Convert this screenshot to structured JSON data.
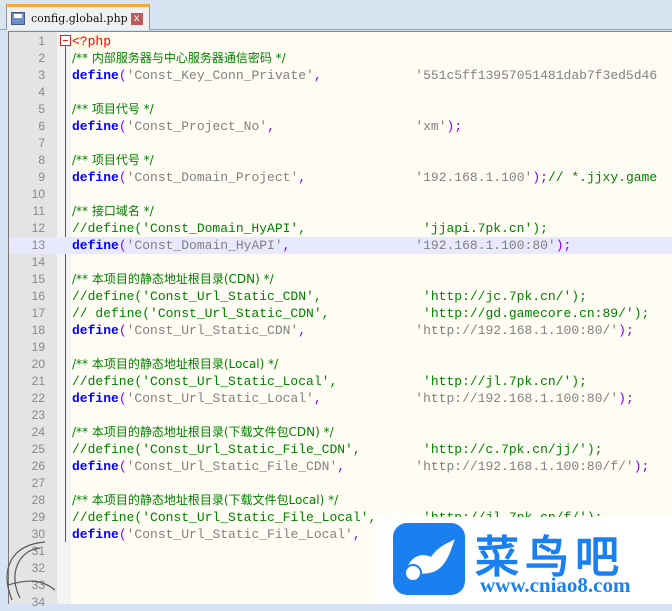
{
  "tab": {
    "filename": "config.global.php",
    "close": "x"
  },
  "highlighted_line": 13,
  "lines": [
    [
      {
        "t": "<?php",
        "c": "php"
      }
    ],
    [
      {
        "t": "/** 内部服务器与中心服务器通信密码 */",
        "c": "cmc"
      }
    ],
    [
      {
        "t": "define",
        "c": "kw"
      },
      {
        "t": "(",
        "c": "op"
      },
      {
        "t": "'Const_Key_Conn_Private'",
        "c": "str"
      },
      {
        "t": ",",
        "c": "op"
      },
      {
        "t": "            ",
        "c": ""
      },
      {
        "t": "'551c5ff13957051481dab7f3ed5d46",
        "c": "str"
      }
    ],
    [],
    [
      {
        "t": "/** 项目代号 */",
        "c": "cmc"
      }
    ],
    [
      {
        "t": "define",
        "c": "kw"
      },
      {
        "t": "(",
        "c": "op"
      },
      {
        "t": "'Const_Project_No'",
        "c": "str"
      },
      {
        "t": ",",
        "c": "op"
      },
      {
        "t": "                  ",
        "c": ""
      },
      {
        "t": "'xm'",
        "c": "str"
      },
      {
        "t": ");",
        "c": "op"
      }
    ],
    [],
    [
      {
        "t": "/** 项目代号 */",
        "c": "cmc"
      }
    ],
    [
      {
        "t": "define",
        "c": "kw"
      },
      {
        "t": "(",
        "c": "op"
      },
      {
        "t": "'Const_Domain_Project'",
        "c": "str"
      },
      {
        "t": ",",
        "c": "op"
      },
      {
        "t": "              ",
        "c": ""
      },
      {
        "t": "'192.168.1.100'",
        "c": "str"
      },
      {
        "t": ");",
        "c": "op"
      },
      {
        "t": "// *.jjxy.game",
        "c": "cm"
      }
    ],
    [],
    [
      {
        "t": "/** 接口域名 */",
        "c": "cmc"
      }
    ],
    [
      {
        "t": "//define('Const_Domain_HyAPI',               'jjapi.7pk.cn');",
        "c": "cm"
      }
    ],
    [
      {
        "t": "define",
        "c": "kw"
      },
      {
        "t": "(",
        "c": "op"
      },
      {
        "t": "'Const_Domain_HyAPI'",
        "c": "str"
      },
      {
        "t": ",",
        "c": "op"
      },
      {
        "t": "                ",
        "c": ""
      },
      {
        "t": "'192.168.1.100:80'",
        "c": "str"
      },
      {
        "t": ");",
        "c": "op"
      }
    ],
    [],
    [
      {
        "t": "/** 本项目的静态地址根目录(CDN) */",
        "c": "cmc"
      }
    ],
    [
      {
        "t": "//define('Const_Url_Static_CDN',             'http://jc.7pk.cn/');",
        "c": "cm"
      }
    ],
    [
      {
        "t": "// define('Const_Url_Static_CDN',            'http://gd.gamecore.cn:89/');",
        "c": "cm"
      }
    ],
    [
      {
        "t": "define",
        "c": "kw"
      },
      {
        "t": "(",
        "c": "op"
      },
      {
        "t": "'Const_Url_Static_CDN'",
        "c": "str"
      },
      {
        "t": ",",
        "c": "op"
      },
      {
        "t": "              ",
        "c": ""
      },
      {
        "t": "'http://192.168.1.100:80/'",
        "c": "str"
      },
      {
        "t": ");",
        "c": "op"
      }
    ],
    [],
    [
      {
        "t": "/** 本项目的静态地址根目录(Local) */",
        "c": "cmc"
      }
    ],
    [
      {
        "t": "//define('Const_Url_Static_Local',           'http://jl.7pk.cn/');",
        "c": "cm"
      }
    ],
    [
      {
        "t": "define",
        "c": "kw"
      },
      {
        "t": "(",
        "c": "op"
      },
      {
        "t": "'Const_Url_Static_Local'",
        "c": "str"
      },
      {
        "t": ",",
        "c": "op"
      },
      {
        "t": "            ",
        "c": ""
      },
      {
        "t": "'http://192.168.1.100:80/'",
        "c": "str"
      },
      {
        "t": ");",
        "c": "op"
      }
    ],
    [],
    [
      {
        "t": "/** 本项目的静态地址根目录(下载文件包CDN) */",
        "c": "cmc"
      }
    ],
    [
      {
        "t": "//define('Const_Url_Static_File_CDN',        'http://c.7pk.cn/jj/');",
        "c": "cm"
      }
    ],
    [
      {
        "t": "define",
        "c": "kw"
      },
      {
        "t": "(",
        "c": "op"
      },
      {
        "t": "'Const_Url_Static_File_CDN'",
        "c": "str"
      },
      {
        "t": ",",
        "c": "op"
      },
      {
        "t": "         ",
        "c": ""
      },
      {
        "t": "'http://192.168.1.100:80/f/'",
        "c": "str"
      },
      {
        "t": ");",
        "c": "op"
      }
    ],
    [],
    [
      {
        "t": "/** 本项目的静态地址根目录(下载文件包Local) */",
        "c": "cmc"
      }
    ],
    [
      {
        "t": "//define('Const_Url_Static_File_Local',      'http://jl.7pk.cn/f/');",
        "c": "cm"
      }
    ],
    [
      {
        "t": "define",
        "c": "kw"
      },
      {
        "t": "(",
        "c": "op"
      },
      {
        "t": "'Const_Url_Static_File_Local'",
        "c": "str"
      },
      {
        "t": ",",
        "c": "op"
      }
    ],
    [],
    [],
    [],
    []
  ],
  "watermark": {
    "name": "菜鸟吧",
    "url": "www.cniao8.com"
  }
}
